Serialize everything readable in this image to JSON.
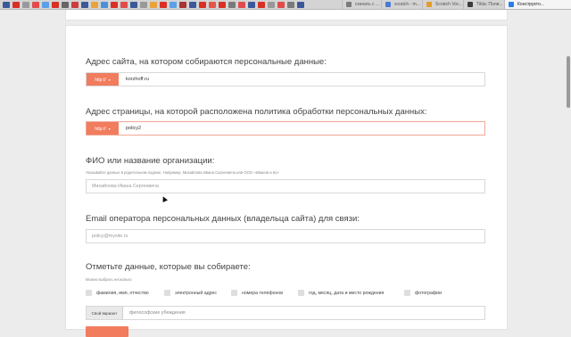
{
  "browser": {
    "tabs": [
      {
        "title": "скачать с ...",
        "color": "#7a7a7a"
      },
      {
        "title": "scratch - m...",
        "color": "#4a7bd0"
      },
      {
        "title": "Scratch Voc...",
        "color": "#e49b2a"
      },
      {
        "title": "Tilda: Поли...",
        "color": "#3c3c3c"
      },
      {
        "title": "Конструкто...",
        "color": "#2b7de9"
      }
    ],
    "bookmark_colors": [
      "#3b5998",
      "#d93025",
      "#999999",
      "#e24b4b",
      "#5aa0e6",
      "#d93025",
      "#666666",
      "#cc3d3d",
      "#3b5998",
      "#e8a33c",
      "#4a90d9",
      "#d93025",
      "#e24b4b",
      "#3b5998",
      "#999999",
      "#e8a33c",
      "#d93025",
      "#5aa0e6",
      "#aa3333",
      "#3b5998",
      "#d93025",
      "#e2574c",
      "#d93025",
      "#7a7a7a",
      "#e24b4b",
      "#3b5998",
      "#d93025",
      "#999999",
      "#e24b4b",
      "#7a7a7a",
      "#3b5998"
    ]
  },
  "form": {
    "site_url": {
      "question": "Адрес сайта, на котором собираются персональные данные:",
      "protocol": "http://",
      "value": "korzhoff.ru"
    },
    "policy_url": {
      "question": "Адрес страницы, на которой расположена политика обработки персональных данных:",
      "protocol": "http://",
      "value": "policy2"
    },
    "owner_name": {
      "question": "ФИО или название организации:",
      "hint": "Указывайте данные в родительном падеже. Например, Михайлова Ивана Сергеевича или ООО «Иванов и Ко»",
      "placeholder": "Михайлова Ивана Сергеевича"
    },
    "owner_email": {
      "question": "Email оператора персональных данных (владельца сайта) для связи:",
      "placeholder": "policy@mysite.ru"
    },
    "collected_data": {
      "question": "Отметьте данные, которые вы собираете:",
      "hint": "Можно выбрать несколько",
      "options": [
        "фамилия, имя, отчество",
        "электронный адрес",
        "номера телефонов",
        "год, месяц, дата и место рождения",
        "фотографии"
      ],
      "custom_button": "Свой вариант",
      "custom_placeholder": "философские убеждения"
    }
  },
  "colors": {
    "accent": "#f17c5e",
    "error_border": "#f0a896"
  }
}
